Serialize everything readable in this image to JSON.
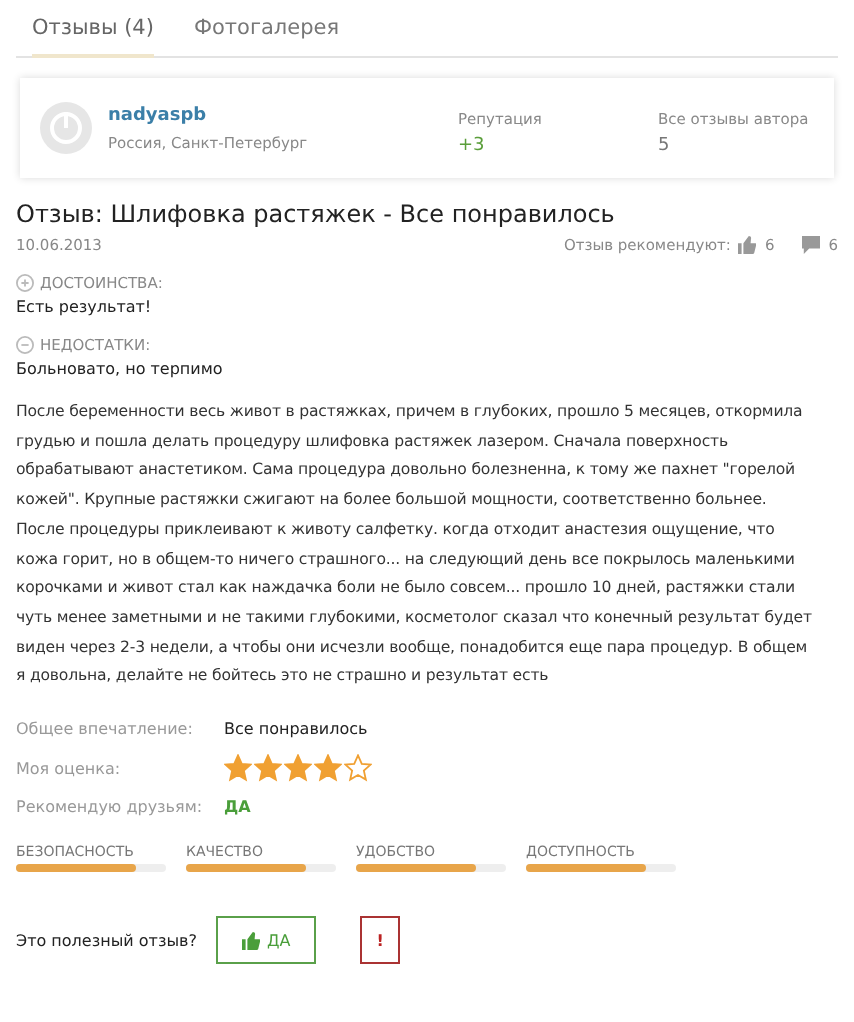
{
  "tabs": [
    {
      "label": "Отзывы (4)",
      "selected": true
    },
    {
      "label": "Фотогалерея",
      "selected": false
    }
  ],
  "author": {
    "name": "nadyaspb",
    "location": "Россия, Санкт-Петербург",
    "reputation_label": "Репутация",
    "reputation": "+3",
    "reviews_label": "Все отзывы автора",
    "reviews": "5"
  },
  "review": {
    "title": "Отзыв: Шлифовка растяжек - Все понравилось",
    "date": "10.06.2013",
    "recommend_label": "Отзыв рекомендуют:",
    "likes": "6",
    "comments": "6",
    "pros_label": "ДОСТОИНСТВА:",
    "pros": "Есть результат!",
    "cons_label": "НЕДОСТАТКИ:",
    "cons": "Больновато, но терпимо",
    "text": "После беременности весь живот в растяжках, причем в глубоких, прошло 5 месяцев, откормила грудью и пошла делать процедуру шлифовка растяжек лазером. Сначала поверхность обрабатывают анастетиком. Сама процедура довольно болезненна, к тому же пахнет \"горелой кожей\". Крупные растяжки сжигают на более большой мощности, соответственно больнее. После процедуры приклеивают к животу салфетку. когда отходит анастезия ощущение, что кожа горит, но в общем-то ничего страшного... на следующий день все покрылось маленькими корочками и живот стал как наждачка боли не было совсем... прошло 10 дней, растяжки стали чуть менее заметными и не такими глубокими, косметолог сказал что конечный результат будет виден через 2-3 недели, а чтобы они исчезли вообще, понадобится еще пара процедур. В общем я довольна, делайте не бойтесь это не страшно и результат есть"
  },
  "summary": {
    "impression_label": "Общее впечатление:",
    "impression": "Все понравилось",
    "rating_label": "Моя оценка:",
    "stars": 4,
    "recommend_label": "Рекомендую друзьям:",
    "recommend": "ДА"
  },
  "meters": [
    {
      "label": "БЕЗОПАСНОСТЬ",
      "level": 0.8
    },
    {
      "label": "КАЧЕСТВО",
      "level": 0.8
    },
    {
      "label": "УДОБСТВО",
      "level": 0.8
    },
    {
      "label": "ДОСТУПНОСТЬ",
      "level": 0.8
    }
  ],
  "useful": {
    "question": "Это полезный отзыв?",
    "yes": "ДА",
    "report": "!"
  }
}
